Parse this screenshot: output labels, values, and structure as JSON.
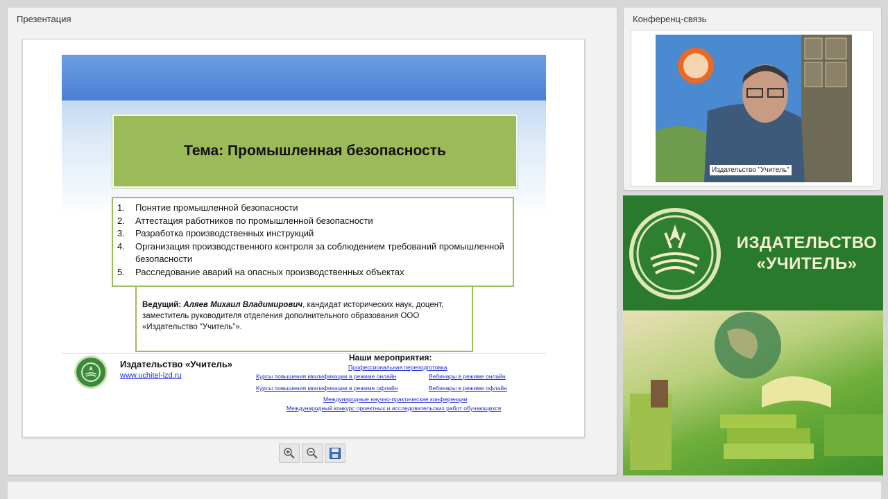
{
  "presentation_panel": {
    "title": "Презентация",
    "slide": {
      "title": "Тема: Промышленная безопасность",
      "topics": [
        {
          "num": "1.",
          "text": "Понятие промышленной безопасности"
        },
        {
          "num": "2.",
          "text": "Аттестация работников по промышленной безопасности"
        },
        {
          "num": "3.",
          "text": "Разработка производственных инструкций"
        },
        {
          "num": "4.",
          "text": "Организация производственного контроля за соблюдением требований промышленной безопасности"
        },
        {
          "num": "5.",
          "text": "Расследование аварий на опасных производственных объектах"
        }
      ],
      "host_label": "Ведущий:",
      "host_name": "Аляев Михаил Владимирович",
      "host_desc": ", кандидат исторических наук, доцент, заместитель руководителя отделения дополнительного образования ООО «Издательство “Учитель”».",
      "publisher_name": "Издательство «Учитель»",
      "publisher_url": "www.uchitel-izd.ru",
      "events_title": "Наши мероприятия:",
      "events": {
        "prof_retraining": "Профессиональная переподготовка",
        "courses_online": "Курсы повышения квалификации в режиме онлайн",
        "webinars_online": "Вебинары в режиме онлайн",
        "courses_offline": "Курсы повышения квалификации в режиме офлайн",
        "webinars_offline": "Вебинары в режиме офлайн",
        "conferences": "Международные научно-практические конференции",
        "contest": "Международный конкурс проектных и исследовательских работ обучающихся"
      }
    },
    "toolbar": {
      "zoom_in_icon": "zoom-in-icon",
      "zoom_out_icon": "zoom-out-icon",
      "save_icon": "save-icon"
    }
  },
  "conference_panel": {
    "title": "Конференц-связь",
    "video_caption": "Издательство \"Учитель\""
  },
  "promo": {
    "line1": "ИЗДАТЕЛЬСТВО",
    "line2": "«УЧИТЕЛЬ»"
  },
  "colors": {
    "slide_green": "#9bbb59",
    "promo_green": "#2a7a2e",
    "link_blue": "#1a2bd8"
  }
}
